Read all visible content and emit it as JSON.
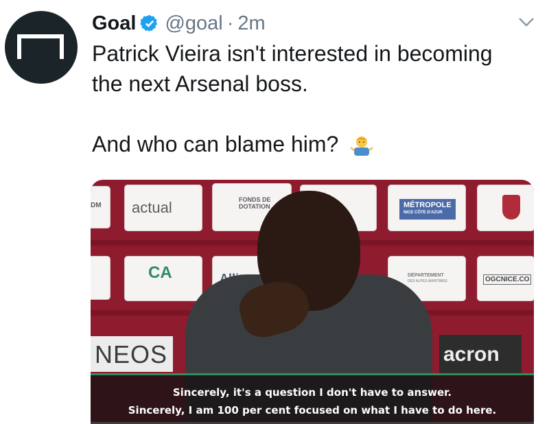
{
  "tweet": {
    "display_name": "Goal",
    "handle": "@goal",
    "separator": "·",
    "time": "2m",
    "line1": "Patrick Vieira isn't interested in becoming",
    "line2": "the next Arsenal boss.",
    "line3": "And who can blame him?",
    "emoji": "person-shrugging-icon"
  },
  "media": {
    "boards": {
      "actual": "actual",
      "fonds": "FONDS DE DOTATION",
      "metropole": "MÉTROPOLE",
      "metropole_sub": "NICE CÔTE D'AZUR",
      "allianz": "Allianz",
      "departement": "DÉPARTEMENT",
      "departement_sub": "DES ALPES-MARITIMES",
      "ogcnice": "OGCNICE.CO",
      "dm": "DM"
    },
    "neos": "NEOS",
    "acron": "acron",
    "subtitle_1": "Sincerely, it's a question I don't have to answer.",
    "subtitle_2": "Sincerely, I am 100 per cent focused on what I have to do here."
  },
  "colors": {
    "verified": "#1da1f2",
    "media_bg": "#8f1b2e",
    "avatar_bg": "#1b2429"
  }
}
